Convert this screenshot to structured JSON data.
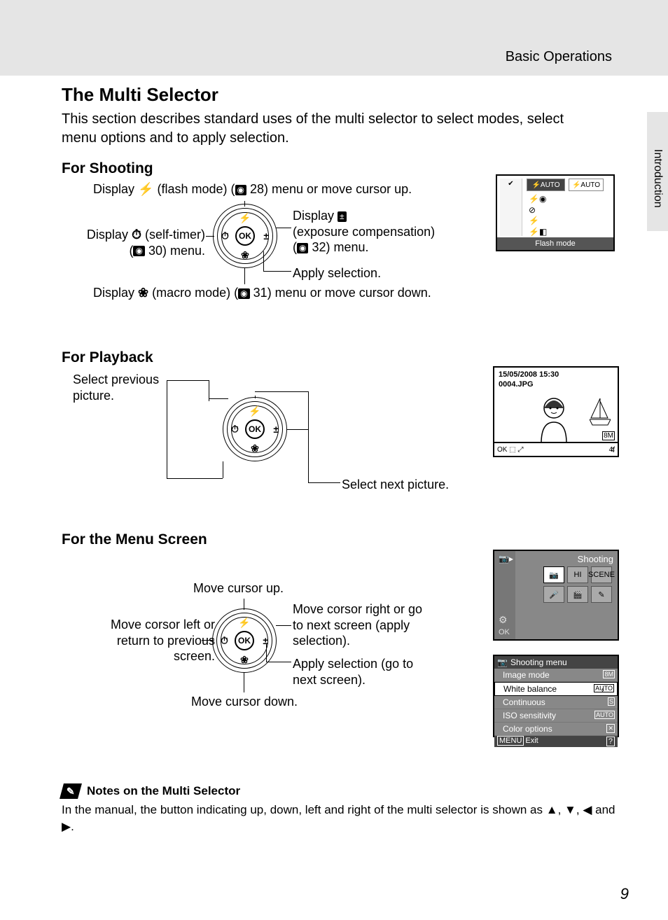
{
  "header": {
    "breadcrumb": "Basic Operations",
    "sidetab": "Introduction"
  },
  "title": "The Multi Selector",
  "intro": "This section describes standard uses of the multi selector to select modes, select menu options and to apply selection.",
  "shooting": {
    "heading": "For Shooting",
    "up_pre": "Display ",
    "up_mid": " (flash mode) (",
    "up_page": "28",
    "up_post": ") menu or move cursor up.",
    "left_pre": "Display ",
    "left_mid": " (self-timer)",
    "left_post_pre": "(",
    "left_page": "30",
    "left_post": ") menu.",
    "right_pre": "Display ",
    "right_mid": "(exposure compensation)",
    "right_post_pre": "(",
    "right_page": "32",
    "right_post": ") menu.",
    "ok": "Apply selection.",
    "down_pre": "Display ",
    "down_mid": " (macro mode) (",
    "down_page": "31",
    "down_post": ") menu or move cursor down.",
    "thumb": {
      "tab1": "⚡AUTO",
      "tab2": "⚡AUTO",
      "footer": "Flash mode",
      "leftcheck": "✔"
    }
  },
  "playback": {
    "heading": "For Playback",
    "prev": "Select previous picture.",
    "next": "Select next picture.",
    "thumb": {
      "timestamp": "15/05/2008 15:30",
      "filename": "0004.JPG",
      "counter": "4/",
      "total": "4",
      "size": "8M"
    }
  },
  "menu": {
    "heading": "For the Menu Screen",
    "up": "Move cursor up.",
    "left": "Move corsor left or return to previous screen.",
    "right": "Move corsor right or go to next screen (apply selection).",
    "ok": "Apply selection (go to next screen).",
    "down": "Move cursor down.",
    "thumb3": {
      "title": "Shooting",
      "icons": [
        "📷",
        "HI",
        "SCENE",
        "🎤",
        "🎬",
        "✎"
      ]
    },
    "thumb4": {
      "title": "Shooting menu",
      "rows": [
        {
          "label": "Image mode",
          "tag": "8M"
        },
        {
          "label": "White balance",
          "tag": "AUTO",
          "selected": true
        },
        {
          "label": "Continuous",
          "tag": "S"
        },
        {
          "label": "ISO sensitivity",
          "tag": "AUTO"
        },
        {
          "label": "Color options",
          "tag": "✕"
        }
      ],
      "exit_label": "MENU",
      "exit_text": "Exit",
      "help": "?"
    }
  },
  "notes": {
    "heading": "Notes on the Multi Selector",
    "text_pre": "In the manual, the button indicating up, down, left and right of the multi selector is shown as ",
    "and": " and ",
    "period": "."
  },
  "page_number": "9",
  "selector_center": "OK"
}
